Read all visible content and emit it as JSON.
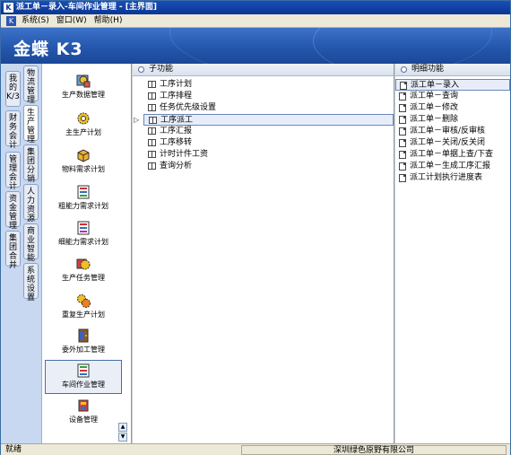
{
  "window": {
    "title": "派工单－录入-车间作业管理 - [主界面]"
  },
  "menubar": {
    "items": [
      "系统(S)",
      "窗口(W)",
      "帮助(H)"
    ]
  },
  "banner": {
    "brand": "金蝶",
    "product": "K/3"
  },
  "left_tabs": [
    {
      "label": "我的K/3"
    },
    {
      "label": "物流管理"
    },
    {
      "label": "财务会计"
    },
    {
      "label": "生产管理"
    },
    {
      "label": "管理会计"
    },
    {
      "label": "集团分销"
    },
    {
      "label": "资金管理"
    },
    {
      "label": "人力资源"
    },
    {
      "label": "集团合并"
    },
    {
      "label": "商业智能"
    },
    {
      "label": "系统设置"
    }
  ],
  "modules": [
    {
      "label": "生产数据管理",
      "icon": "production-data-icon"
    },
    {
      "label": "主生产计划",
      "icon": "master-plan-gear-icon"
    },
    {
      "label": "物料需求计划",
      "icon": "material-box-icon"
    },
    {
      "label": "粗能力需求计划",
      "icon": "rough-capacity-icon"
    },
    {
      "label": "细能力需求计划",
      "icon": "fine-capacity-icon"
    },
    {
      "label": "生产任务管理",
      "icon": "task-gear-icon"
    },
    {
      "label": "重复生产计划",
      "icon": "repeat-gear-icon"
    },
    {
      "label": "委外加工管理",
      "icon": "outsource-door-icon"
    },
    {
      "label": "车间作业管理",
      "icon": "workshop-icon"
    },
    {
      "label": "设备管理",
      "icon": "equipment-icon"
    }
  ],
  "sub_panel": {
    "header": "子功能",
    "items": [
      "工序计划",
      "工序排程",
      "任务优先级设置",
      "工序派工",
      "工序汇报",
      "工序移转",
      "计时计件工资",
      "查询分析"
    ],
    "selected": "工序派工"
  },
  "detail_panel": {
    "header": "明细功能",
    "items": [
      "派工单－录入",
      "派工单－查询",
      "派工单－修改",
      "派工单－删除",
      "派工单－审核/反审核",
      "派工单－关闭/反关闭",
      "派工单－单据上查/下查",
      "派工单－生成工序汇报",
      "派工计划执行进度表"
    ],
    "selected": "派工单－录入"
  },
  "status": {
    "left": "就绪",
    "company": "深圳绿色原野有限公司"
  },
  "colors": {
    "title_bar": "#0b3592",
    "banner": "#2457ad",
    "nav_bg": "#d7e3f6"
  }
}
